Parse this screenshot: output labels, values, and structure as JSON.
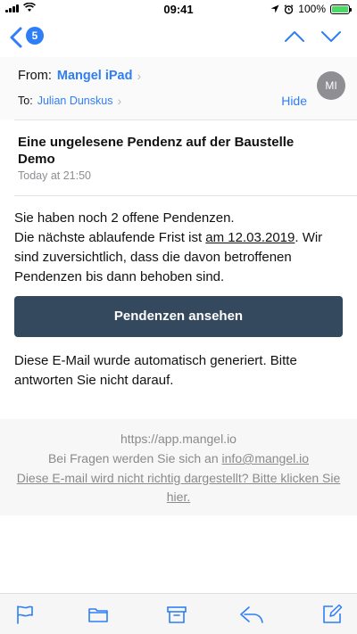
{
  "status_bar": {
    "time": "09:41",
    "battery": "100%"
  },
  "nav": {
    "back_count": "5",
    "icons": [
      "back-chevron-icon",
      "arrow-up-icon",
      "arrow-down-icon"
    ]
  },
  "header": {
    "from_label": "From:",
    "from_name": "Mangel iPad",
    "to_label": "To:",
    "to_name": "Julian Dunskus",
    "hide": "Hide",
    "avatar_initials": "MI"
  },
  "message": {
    "subject": "Eine ungelesene Pendenz auf der Baustelle Demo",
    "date": "Today at 21:50",
    "paragraph_1": "Sie haben noch 2 offene Pendenzen.",
    "paragraph_2_before": "Die nächste ablaufende Frist ist ",
    "paragraph_2_link": "am 12.03.2019",
    "paragraph_2_after": ". Wir sind zuversichtlich, dass die davon betroffenen Pendenzen bis dann behoben sind.",
    "button": "Pendenzen ansehen",
    "auto_note": "Diese E-Mail wurde automatisch generiert. Bitte antworten Sie nicht darauf."
  },
  "footer": {
    "url": "https://app.mangel.io",
    "contact_before": "Bei Fragen werden Sie sich an ",
    "contact_email": "info@mangel.io",
    "view_link": "Diese E-mail wird nicht richtig dargestellt? Bitte klicken Sie hier."
  },
  "toolbar": {
    "icons": [
      "flag-icon",
      "folder-icon",
      "archive-icon",
      "reply-icon",
      "compose-icon"
    ]
  },
  "colors": {
    "accent": "#2f7ef6",
    "button": "#34495e",
    "battery": "#4cd964",
    "muted": "#8e8e93"
  }
}
